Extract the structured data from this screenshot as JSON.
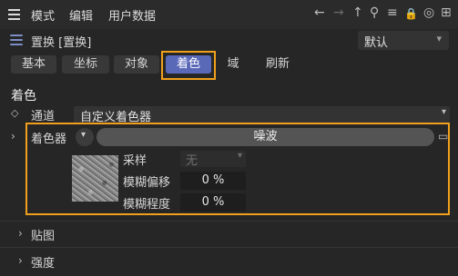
{
  "menu": {
    "items": [
      "模式",
      "编辑",
      "用户数据"
    ],
    "tools": [
      "←",
      "→",
      "↑",
      "⚲",
      "≡",
      "🔒",
      "◎",
      "⊞"
    ]
  },
  "object": {
    "title": "置换 [置换]",
    "preset": "默认"
  },
  "tabs": [
    "基本",
    "坐标",
    "对象",
    "着色",
    "域",
    "刷新"
  ],
  "active_tab": "着色",
  "section": {
    "title": "着色",
    "channel": {
      "label": "通道",
      "value": "自定义着色器"
    },
    "shader": {
      "label": "着色器",
      "value": "噪波"
    },
    "sampling": {
      "label": "采样",
      "value": "无"
    },
    "blur_offset": {
      "label": "模糊偏移",
      "value": "0 %"
    },
    "blur_scale": {
      "label": "模糊程度",
      "value": "0 %"
    }
  },
  "groups": [
    "贴图",
    "强度"
  ],
  "colors": {
    "accent": "#5a68b8",
    "highlight": "#f0a01c",
    "bg": "#262626"
  }
}
